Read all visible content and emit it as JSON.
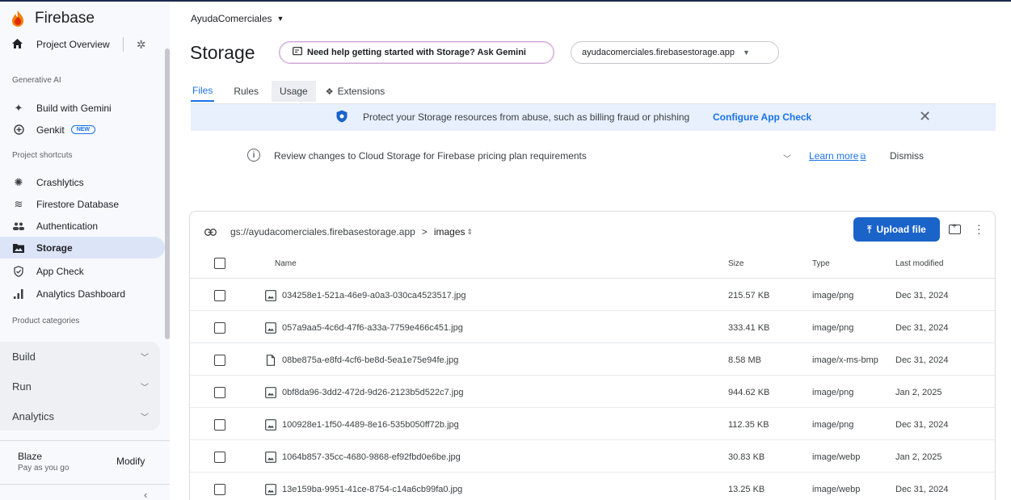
{
  "sidebar": {
    "brand": "Firebase",
    "overview_label": "Project Overview",
    "sections": {
      "generative_ai": "Generative AI",
      "shortcuts": "Project shortcuts",
      "categories": "Product categories"
    },
    "genai_items": [
      {
        "label": "Build with Gemini",
        "icon": "sparkle-icon"
      },
      {
        "label": "Genkit",
        "icon": "genkit-icon",
        "badge": "NEW"
      }
    ],
    "shortcut_items": [
      {
        "label": "Crashlytics",
        "icon": "crashlytics-icon"
      },
      {
        "label": "Firestore Database",
        "icon": "firestore-icon"
      },
      {
        "label": "Authentication",
        "icon": "people-icon"
      },
      {
        "label": "Storage",
        "icon": "folder-image-icon",
        "active": true
      },
      {
        "label": "App Check",
        "icon": "shield-check-icon"
      },
      {
        "label": "Analytics Dashboard",
        "icon": "bar-chart-icon"
      }
    ],
    "categories": [
      {
        "label": "Build"
      },
      {
        "label": "Run"
      },
      {
        "label": "Analytics"
      }
    ],
    "plan": {
      "name": "Blaze",
      "sub": "Pay as you go",
      "action": "Modify"
    }
  },
  "header": {
    "project": "AyudaComerciales",
    "title": "Storage",
    "gemini_button": "Need help getting started with Storage? Ask Gemini",
    "bucket": "ayudacomerciales.firebasestorage.app",
    "tabs": [
      "Files",
      "Rules",
      "Usage",
      "Extensions"
    ],
    "active_tab": "Files"
  },
  "banners": {
    "appcheck_text": "Protect your Storage resources from abuse, such as billing fraud or phishing",
    "appcheck_link": "Configure App Check",
    "pricing_text": "Review changes to Cloud Storage for Firebase pricing plan requirements",
    "learn_more": "Learn more",
    "dismiss": "Dismiss"
  },
  "files": {
    "path_root": "gs://ayudacomerciales.firebasestorage.app",
    "path_sep": ">",
    "path_current": "images",
    "upload_label": "Upload file",
    "columns": {
      "name": "Name",
      "size": "Size",
      "type": "Type",
      "modified": "Last modified"
    },
    "rows": [
      {
        "name": "034258e1-521a-46e9-a0a3-030ca4523517.jpg",
        "size": "215.57 KB",
        "type": "image/png",
        "modified": "Dec 31, 2024",
        "icon": "image-file-icon"
      },
      {
        "name": "057a9aa5-4c6d-47f6-a33a-7759e466c451.jpg",
        "size": "333.41 KB",
        "type": "image/png",
        "modified": "Dec 31, 2024",
        "icon": "image-file-icon"
      },
      {
        "name": "08be875a-e8fd-4cf6-be8d-5ea1e75e94fe.jpg",
        "size": "8.58 MB",
        "type": "image/x-ms-bmp",
        "modified": "Dec 31, 2024",
        "icon": "file-icon"
      },
      {
        "name": "0bf8da96-3dd2-472d-9d26-2123b5d522c7.jpg",
        "size": "944.62 KB",
        "type": "image/png",
        "modified": "Jan 2, 2025",
        "icon": "image-file-icon"
      },
      {
        "name": "100928e1-1f50-4489-8e16-535b050ff72b.jpg",
        "size": "112.35 KB",
        "type": "image/png",
        "modified": "Dec 31, 2024",
        "icon": "image-file-icon"
      },
      {
        "name": "1064b857-35cc-4680-9868-ef92fbd0e6be.jpg",
        "size": "30.83 KB",
        "type": "image/webp",
        "modified": "Jan 2, 2025",
        "icon": "image-file-icon"
      },
      {
        "name": "13e159ba-9951-41ce-8754-c14a6cb99fa0.jpg",
        "size": "13.25 KB",
        "type": "image/webp",
        "modified": "Dec 31, 2024",
        "icon": "image-file-icon"
      }
    ]
  },
  "colors": {
    "accent": "#1a73e8",
    "upload_bg": "#1a63c9",
    "active_nav": "#dce5f8",
    "banner": "#e8f0fe"
  }
}
